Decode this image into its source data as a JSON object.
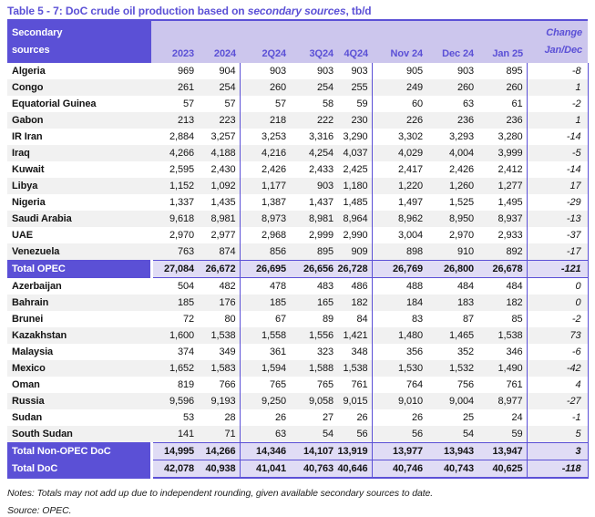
{
  "title": {
    "prefix": "Table 5 - 7: DoC crude oil production based on ",
    "italic": "secondary sources",
    "suffix": ", tb/d"
  },
  "colors": {
    "accent_purple": "#5b50d6",
    "header_band": "#ccc6ed",
    "total_band": "#e0dcf5",
    "row_stripe": "#f1f1f1"
  },
  "header": {
    "col1_line1": "Secondary",
    "col1_line2": "sources",
    "columns": [
      "2023",
      "2024",
      "2Q24",
      "3Q24",
      "4Q24",
      "Nov 24",
      "Dec 24",
      "Jan 25"
    ],
    "change_line1": "Change",
    "change_line2": "Jan/Dec"
  },
  "table": {
    "rows": [
      {
        "label": "Algeria",
        "type": "country",
        "values": [
          "969",
          "904",
          "903",
          "903",
          "903",
          "905",
          "903",
          "895",
          "-8"
        ]
      },
      {
        "label": "Congo",
        "type": "country",
        "values": [
          "261",
          "254",
          "260",
          "254",
          "255",
          "249",
          "260",
          "260",
          "1"
        ]
      },
      {
        "label": "Equatorial Guinea",
        "type": "country",
        "values": [
          "57",
          "57",
          "57",
          "58",
          "59",
          "60",
          "63",
          "61",
          "-2"
        ]
      },
      {
        "label": "Gabon",
        "type": "country",
        "values": [
          "213",
          "223",
          "218",
          "222",
          "230",
          "226",
          "236",
          "236",
          "1"
        ]
      },
      {
        "label": "IR Iran",
        "type": "country",
        "values": [
          "2,884",
          "3,257",
          "3,253",
          "3,316",
          "3,290",
          "3,302",
          "3,293",
          "3,280",
          "-14"
        ]
      },
      {
        "label": "Iraq",
        "type": "country",
        "values": [
          "4,266",
          "4,188",
          "4,216",
          "4,254",
          "4,037",
          "4,029",
          "4,004",
          "3,999",
          "-5"
        ]
      },
      {
        "label": "Kuwait",
        "type": "country",
        "values": [
          "2,595",
          "2,430",
          "2,426",
          "2,433",
          "2,425",
          "2,417",
          "2,426",
          "2,412",
          "-14"
        ]
      },
      {
        "label": "Libya",
        "type": "country",
        "values": [
          "1,152",
          "1,092",
          "1,177",
          "903",
          "1,180",
          "1,220",
          "1,260",
          "1,277",
          "17"
        ]
      },
      {
        "label": "Nigeria",
        "type": "country",
        "values": [
          "1,337",
          "1,435",
          "1,387",
          "1,437",
          "1,485",
          "1,497",
          "1,525",
          "1,495",
          "-29"
        ]
      },
      {
        "label": "Saudi Arabia",
        "type": "country",
        "values": [
          "9,618",
          "8,981",
          "8,973",
          "8,981",
          "8,964",
          "8,962",
          "8,950",
          "8,937",
          "-13"
        ]
      },
      {
        "label": "UAE",
        "type": "country",
        "values": [
          "2,970",
          "2,977",
          "2,968",
          "2,999",
          "2,990",
          "3,004",
          "2,970",
          "2,933",
          "-37"
        ]
      },
      {
        "label": "Venezuela",
        "type": "country",
        "values": [
          "763",
          "874",
          "856",
          "895",
          "909",
          "898",
          "910",
          "892",
          "-17"
        ]
      },
      {
        "label": "Total  OPEC",
        "type": "total",
        "values": [
          "27,084",
          "26,672",
          "26,695",
          "26,656",
          "26,728",
          "26,769",
          "26,800",
          "26,678",
          "-121"
        ]
      },
      {
        "label": "Azerbaijan",
        "type": "country",
        "values": [
          "504",
          "482",
          "478",
          "483",
          "486",
          "488",
          "484",
          "484",
          "0"
        ]
      },
      {
        "label": "Bahrain",
        "type": "country",
        "values": [
          "185",
          "176",
          "185",
          "165",
          "182",
          "184",
          "183",
          "182",
          "0"
        ]
      },
      {
        "label": "Brunei",
        "type": "country",
        "values": [
          "72",
          "80",
          "67",
          "89",
          "84",
          "83",
          "87",
          "85",
          "-2"
        ]
      },
      {
        "label": "Kazakhstan",
        "type": "country",
        "values": [
          "1,600",
          "1,538",
          "1,558",
          "1,556",
          "1,421",
          "1,480",
          "1,465",
          "1,538",
          "73"
        ]
      },
      {
        "label": "Malaysia",
        "type": "country",
        "values": [
          "374",
          "349",
          "361",
          "323",
          "348",
          "356",
          "352",
          "346",
          "-6"
        ]
      },
      {
        "label": "Mexico",
        "type": "country",
        "values": [
          "1,652",
          "1,583",
          "1,594",
          "1,588",
          "1,538",
          "1,530",
          "1,532",
          "1,490",
          "-42"
        ]
      },
      {
        "label": "Oman",
        "type": "country",
        "values": [
          "819",
          "766",
          "765",
          "765",
          "761",
          "764",
          "756",
          "761",
          "4"
        ]
      },
      {
        "label": "Russia",
        "type": "country",
        "values": [
          "9,596",
          "9,193",
          "9,250",
          "9,058",
          "9,015",
          "9,010",
          "9,004",
          "8,977",
          "-27"
        ]
      },
      {
        "label": "Sudan",
        "type": "country",
        "values": [
          "53",
          "28",
          "26",
          "27",
          "26",
          "26",
          "25",
          "24",
          "-1"
        ]
      },
      {
        "label": "South Sudan",
        "type": "country",
        "values": [
          "141",
          "71",
          "63",
          "54",
          "56",
          "56",
          "54",
          "59",
          "5"
        ]
      },
      {
        "label": "Total Non-OPEC DoC",
        "type": "total",
        "values": [
          "14,995",
          "14,266",
          "14,346",
          "14,107",
          "13,919",
          "13,977",
          "13,943",
          "13,947",
          "3"
        ]
      },
      {
        "label": "Total DoC",
        "type": "total-doc",
        "values": [
          "42,078",
          "40,938",
          "41,041",
          "40,763",
          "40,646",
          "40,746",
          "40,743",
          "40,625",
          "-118"
        ]
      }
    ]
  },
  "notes": "Notes: Totals may not add up due to independent rounding, given available secondary sources to date.",
  "source": "Source: OPEC."
}
